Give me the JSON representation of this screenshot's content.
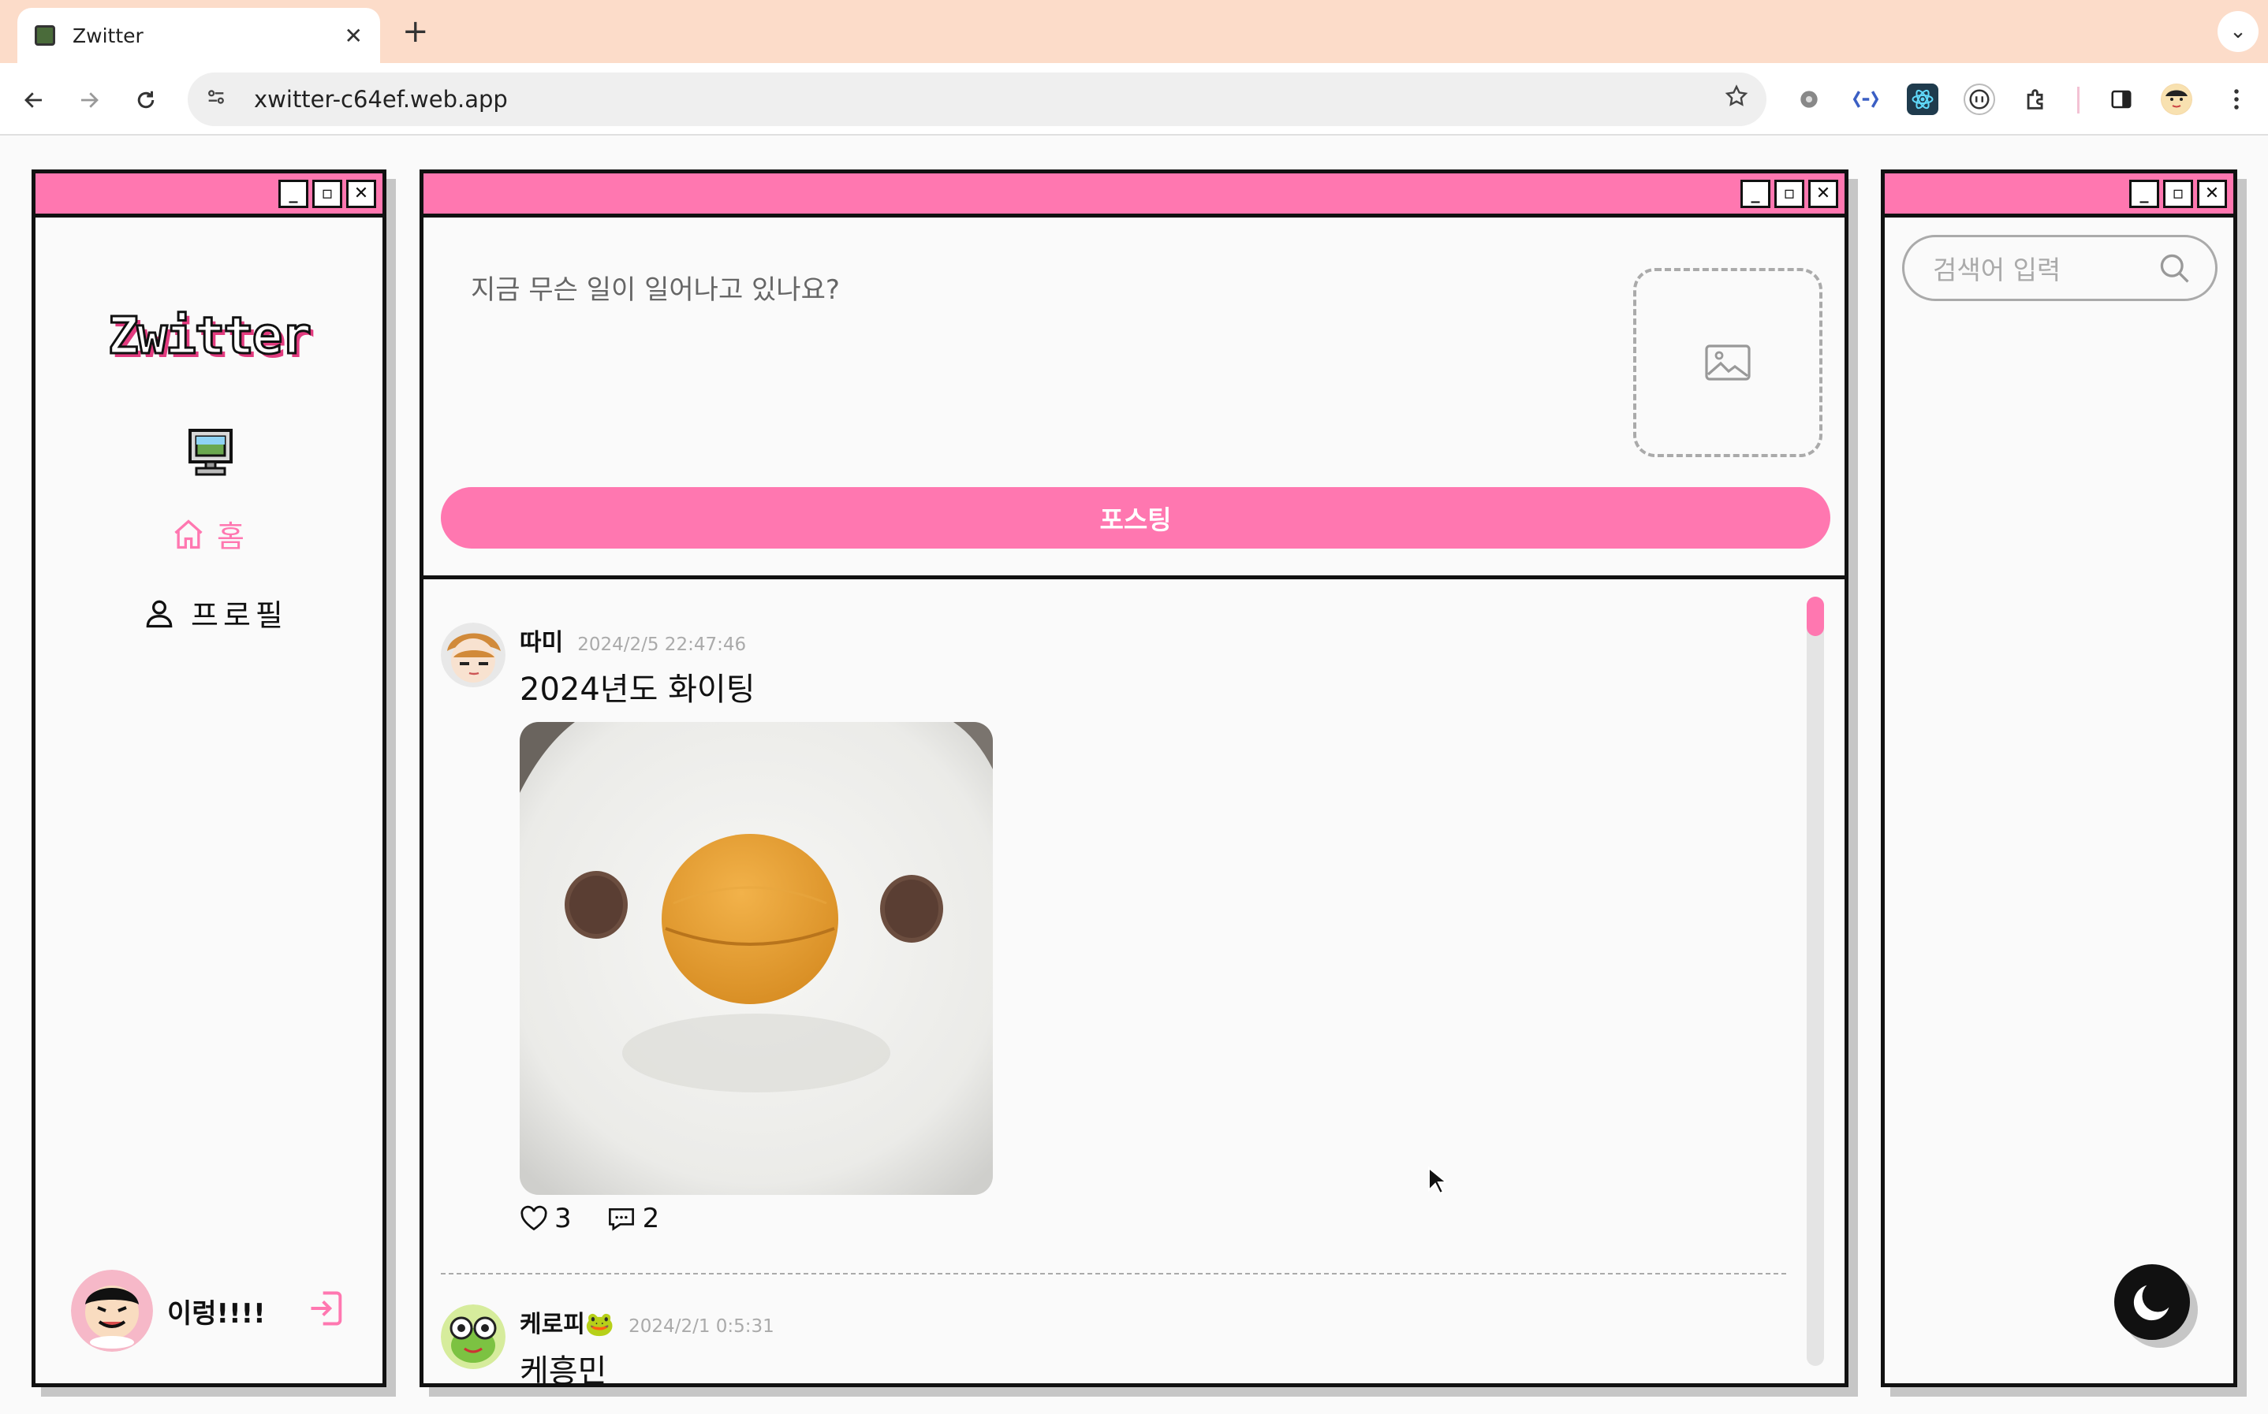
{
  "browser": {
    "tab_title": "Zwitter",
    "tab_close": "✕",
    "new_tab": "+",
    "tab_menu": "⌄",
    "url": "xwitter-c64ef.web.app"
  },
  "window_controls": {
    "minimize": "_",
    "maximize": "▫",
    "close": "✕"
  },
  "sidebar": {
    "logo": "Zwitter",
    "nav": [
      {
        "label": "홈",
        "icon": "home-icon",
        "active": true
      },
      {
        "label": "프로필",
        "icon": "user-icon",
        "active": false
      }
    ],
    "user_name": "이렁!!!!"
  },
  "compose": {
    "placeholder": "지금 무슨 일이 일어나고 있나요?",
    "post_button": "포스팅"
  },
  "feed": {
    "posts": [
      {
        "user": "따미",
        "time": "2024/2/5 22:47:46",
        "body": "2024년도 화이팅",
        "likes": "3",
        "comments": "2"
      },
      {
        "user": "케로피🐸",
        "time": "2024/2/1 0:5:31",
        "body": "케흥민"
      }
    ]
  },
  "search": {
    "placeholder": "검색어 입력"
  },
  "colors": {
    "accent": "#ff77b0",
    "tabbar": "#fcdcc9",
    "border": "#111111"
  }
}
